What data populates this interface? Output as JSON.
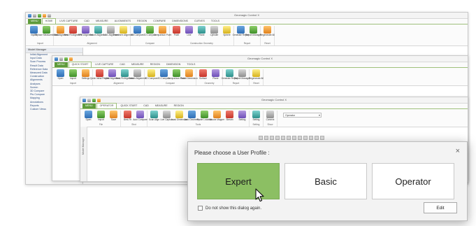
{
  "windows": {
    "back": {
      "title": "Geomagic Control X",
      "tabs": [
        "MENU",
        "HOME",
        "LIVE CAPTURE",
        "CAD",
        "MEASURE",
        "ALIGNMENTS",
        "REGION",
        "COMPARE",
        "DIMENSIONS",
        "CURVES",
        "TOOLS"
      ],
      "ribbon": [
        {
          "name": "Import",
          "buttons": [
            "Import",
            "Replace Measured Data"
          ]
        },
        {
          "name": "Alignment",
          "buttons": [
            "Initial Alignment",
            "Best-Fit Alignment",
            "RPS Alignment",
            "Datum Alignment",
            "3-2-1 Alignment",
            "Transform Alignment"
          ]
        },
        {
          "name": "Compare",
          "buttons": [
            "3D Compare",
            "2D Compare",
            "Comparison Point"
          ]
        },
        {
          "name": "Construction Geometry",
          "buttons": [
            "Point",
            "Line",
            "Plane",
            "Cylinder",
            "Sphere"
          ]
        },
        {
          "name": "Report",
          "buttons": [
            "Generate Report",
            "Report Manager"
          ]
        },
        {
          "name": "Reset",
          "buttons": [
            "Regenerate All"
          ]
        }
      ],
      "nav": {
        "header": "Model Manager",
        "rows": [
          "Initial Alignment",
          "Input Data",
          "Scan Process",
          "Result Data",
          "Reference Data",
          "Measured Data",
          "Construction",
          "Alignments",
          "Analyses",
          "Screen",
          "3D Compare",
          "Pts Compare",
          "Mapping",
          "Annotations",
          "Reports",
          "Custom Views"
        ]
      }
    },
    "mid": {
      "title": "Geomagic Control X",
      "tabs": [
        "MENU",
        "QUICK START",
        "LIVE CAPTURE",
        "CAD",
        "MEASURE",
        "REGION",
        "DIMENSION",
        "TOOLS"
      ],
      "ribbon": [
        {
          "name": "Import",
          "buttons": [
            "Open",
            "Import",
            "Settings"
          ]
        },
        {
          "name": "Alignment",
          "buttons": [
            "Quick Initial Project",
            "Initial Alignment",
            "Best-Fit Alignment",
            "Datum Alignment"
          ]
        },
        {
          "name": "Compare",
          "buttons": [
            "3D Compare",
            "2D Compare",
            "Comparison Point",
            "Smart Dimension"
          ]
        },
        {
          "name": "Geometry",
          "buttons": [
            "Surface",
            "Plane"
          ]
        },
        {
          "name": "Report",
          "buttons": [
            "Generate Report",
            "Report Manager"
          ]
        },
        {
          "name": "Reset",
          "buttons": [
            "Regenerate All"
          ]
        }
      ]
    },
    "front": {
      "title": "Geomagic Control X",
      "tabs": [
        "MENU",
        "OPERATOR",
        "QUICK START",
        "CAD",
        "MEASURE",
        "REGION"
      ],
      "ribbon": [
        {
          "name": "File",
          "buttons": [
            "Open",
            "Import",
            "Save"
          ]
        },
        {
          "name": "Shot",
          "buttons": [
            "Best-Fit",
            "Auto Compare"
          ]
        },
        {
          "name": "Tools",
          "buttons": [
            "Scan Align",
            "Live Capture",
            "Load Dimension",
            "Auto Geometry",
            "Probe Location",
            "Mouse Mapper",
            "Stream",
            "Setting"
          ]
        },
        {
          "name": "Setting",
          "buttons": [
            "Setting"
          ]
        },
        {
          "name": "Show",
          "buttons": [
            "Connect"
          ]
        }
      ],
      "dropdown_value": "Operator",
      "side_label": "Model Manager"
    }
  },
  "dialog": {
    "title": "Please choose a User Profile :",
    "close_label": "×",
    "profiles": [
      {
        "label": "Expert",
        "selected": true
      },
      {
        "label": "Basic",
        "selected": false
      },
      {
        "label": "Operator",
        "selected": false
      }
    ],
    "checkbox_label": "Do not show this dialog again.",
    "checkbox_checked": false,
    "edit_label": "Edit"
  },
  "colors": {
    "accent_green": "#5e9b3b",
    "selected_profile": "#8cbf63"
  }
}
